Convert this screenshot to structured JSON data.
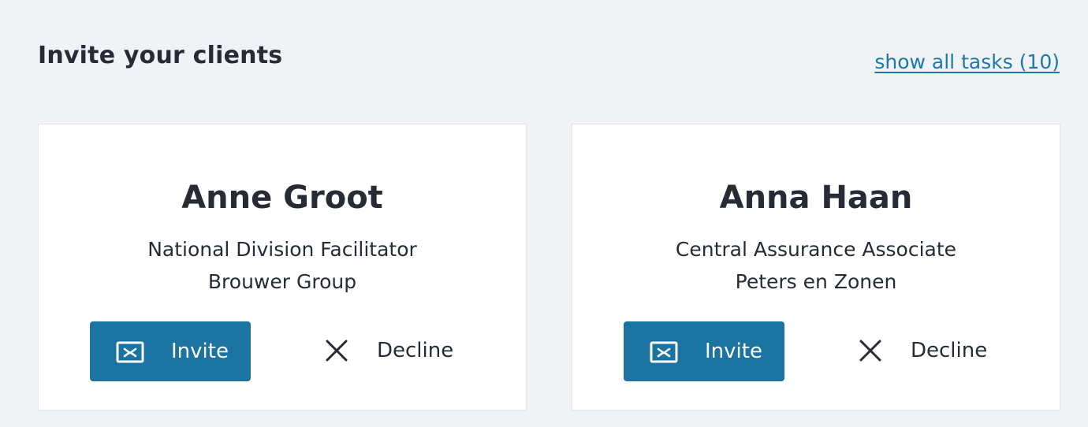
{
  "section": {
    "title": "Invite your clients",
    "show_all_label": "show all tasks (10)"
  },
  "cards": [
    {
      "name": "Anne Groot",
      "role": "National Division Facilitator",
      "company": "Brouwer Group",
      "invite_label": "Invite",
      "decline_label": "Decline"
    },
    {
      "name": "Anna Haan",
      "role": "Central Assurance Associate",
      "company": "Peters en Zonen",
      "invite_label": "Invite",
      "decline_label": "Decline"
    }
  ],
  "icons": {
    "invite": "mail-icon",
    "decline": "close-icon"
  },
  "colors": {
    "background": "#f1f2f5",
    "primary_button": "#1a73a0",
    "link": "#1a7aa8",
    "text": "#262b36"
  }
}
